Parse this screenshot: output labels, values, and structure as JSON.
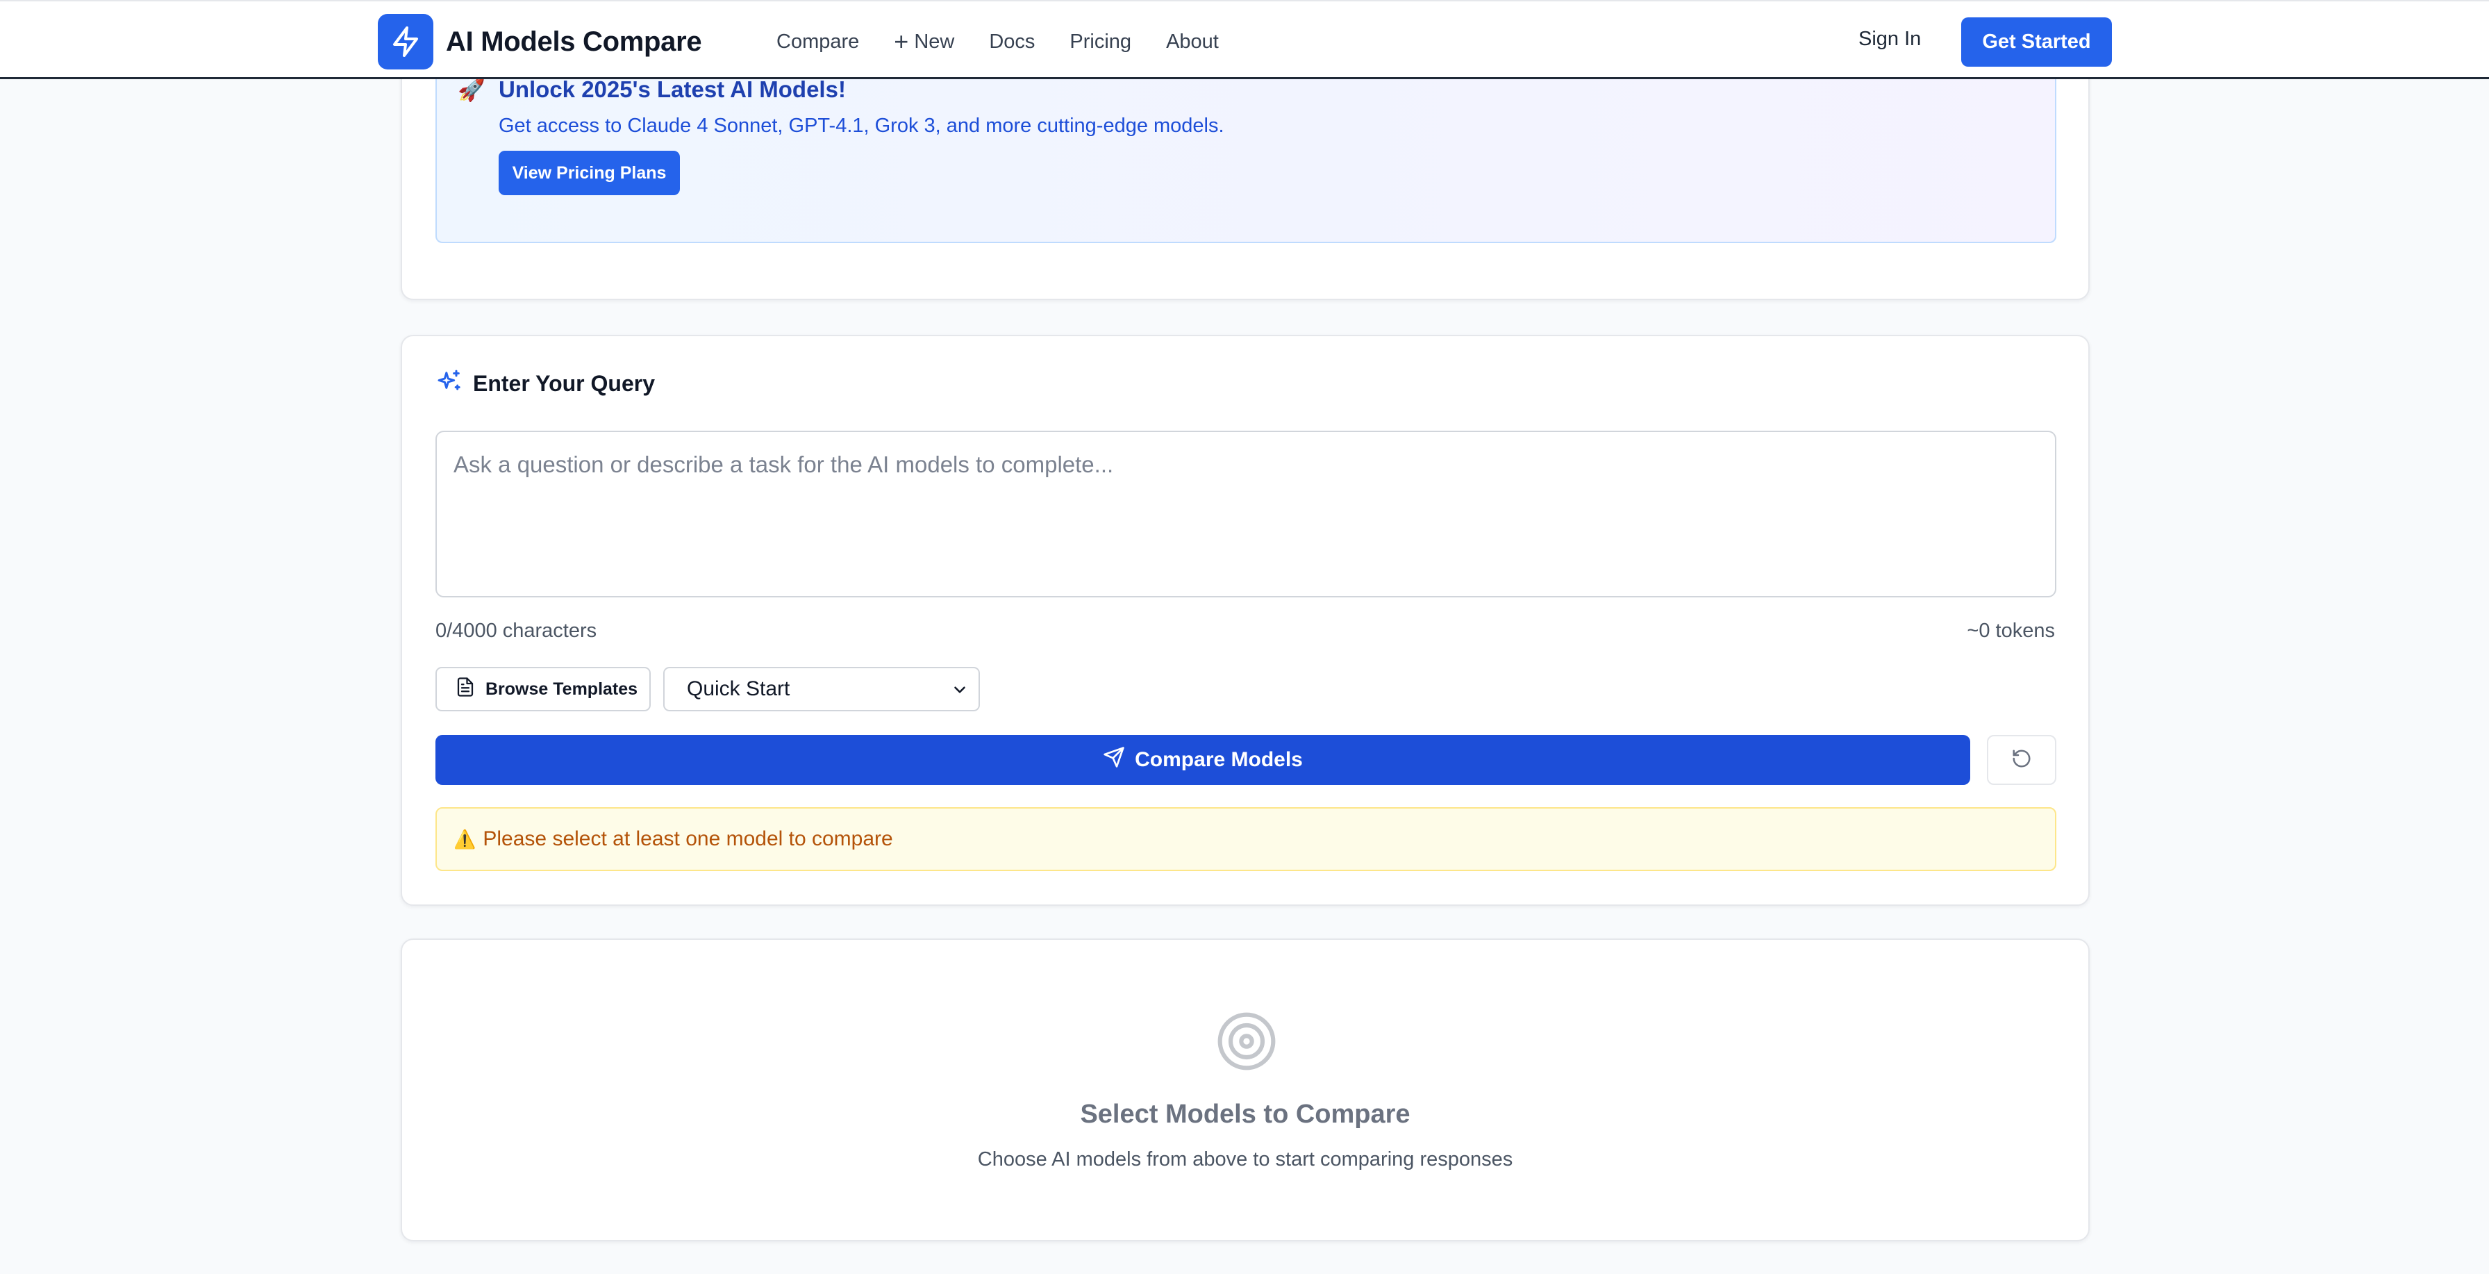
{
  "header": {
    "brand_name": "AI Models Compare",
    "nav": {
      "compare": "Compare",
      "new_plus": "+",
      "new": "New",
      "docs": "Docs",
      "pricing": "Pricing",
      "about": "About"
    },
    "sign_in": "Sign In",
    "get_started": "Get Started"
  },
  "promo": {
    "icon": "🚀",
    "title": "Unlock 2025's Latest AI Models!",
    "subtitle": "Get access to Claude 4 Sonnet, GPT-4.1, Grok 3, and more cutting-edge models.",
    "button": "View Pricing Plans"
  },
  "query": {
    "title": "Enter Your Query",
    "placeholder": "Ask a question or describe a task for the AI models to complete...",
    "char_count": "0/4000 characters",
    "token_count": "~0 tokens",
    "browse_templates": "Browse Templates",
    "template_select_value": "Quick Start",
    "compare_button": "Compare Models",
    "warning_icon": "⚠️",
    "warning_text": "Please select at least one model to compare"
  },
  "empty_state": {
    "title": "Select Models to Compare",
    "subtitle": "Choose AI models from above to start comparing responses"
  },
  "colors": {
    "primary": "#2563eb",
    "primary_dark": "#1d4ed8",
    "warning_text": "#b45309",
    "warning_bg": "#fefce8"
  }
}
